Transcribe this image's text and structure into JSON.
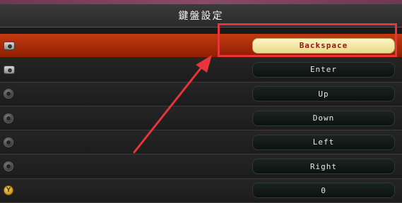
{
  "title": "鍵盤設定",
  "rows": [
    {
      "icon": "camera-icon",
      "key": "Backspace",
      "selected": true
    },
    {
      "icon": "camera-rotate-icon",
      "key": "Enter",
      "selected": false
    },
    {
      "icon": "stick-up-icon",
      "key": "Up",
      "selected": false
    },
    {
      "icon": "stick-down-icon",
      "key": "Down",
      "selected": false
    },
    {
      "icon": "stick-left-icon",
      "key": "Left",
      "selected": false
    },
    {
      "icon": "stick-right-icon",
      "key": "Right",
      "selected": false
    },
    {
      "icon": "y-button-icon",
      "icon_text": "Y",
      "key": "0",
      "selected": false
    }
  ],
  "colors": {
    "selected_row": "#c23a10",
    "active_key_bg": "#fff6c4",
    "annotation": "#e8343a"
  }
}
